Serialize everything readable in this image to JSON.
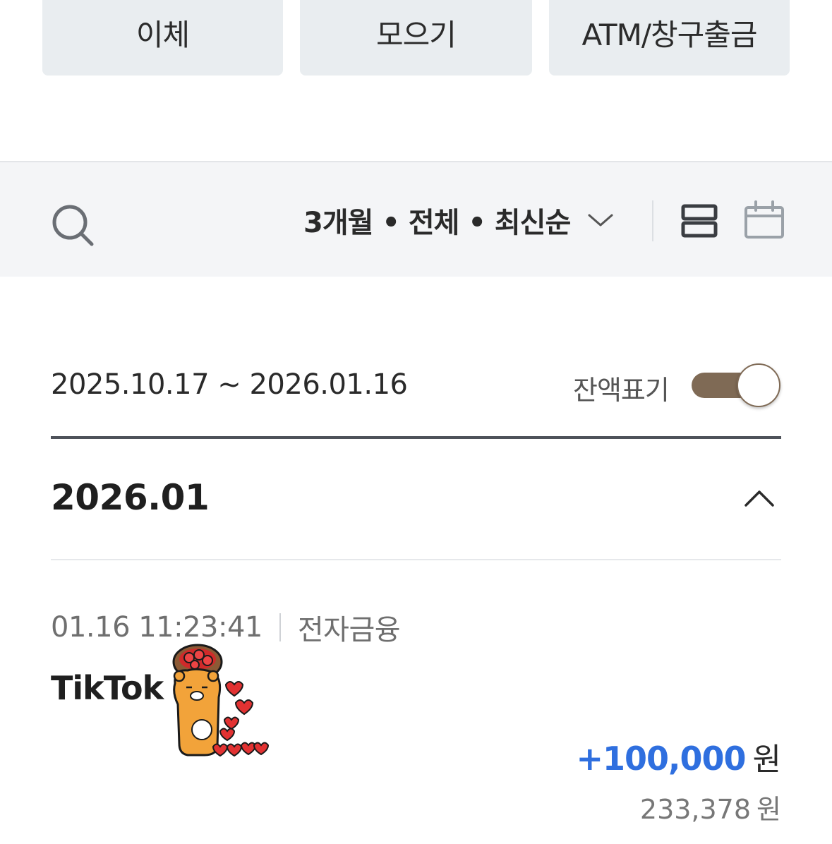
{
  "top_buttons": {
    "transfer": "이체",
    "collect": "모으기",
    "atm": "ATM/창구출금"
  },
  "filter_bar": {
    "search_icon": "search-icon",
    "summary": "3개월 • 전체 • 최신순",
    "list_view_icon": "list-view-icon",
    "calendar_icon": "calendar-icon"
  },
  "range": {
    "date_range": "2025.10.17 ~ 2026.01.16",
    "balance_toggle_label": "잔액표기",
    "balance_toggle_on": true
  },
  "month": {
    "label": "2026.01"
  },
  "transactions": [
    {
      "datetime": "01.16 11:23:41",
      "category": "전자금융",
      "name": "TikTok",
      "amount": "+100,000",
      "amount_unit": "원",
      "balance": "233,378",
      "balance_unit": "원"
    }
  ],
  "colors": {
    "button_bg": "#e9edf0",
    "filter_bg": "#f4f5f7",
    "toggle_on": "#7f6a55",
    "amount_positive": "#2f6fdf"
  }
}
